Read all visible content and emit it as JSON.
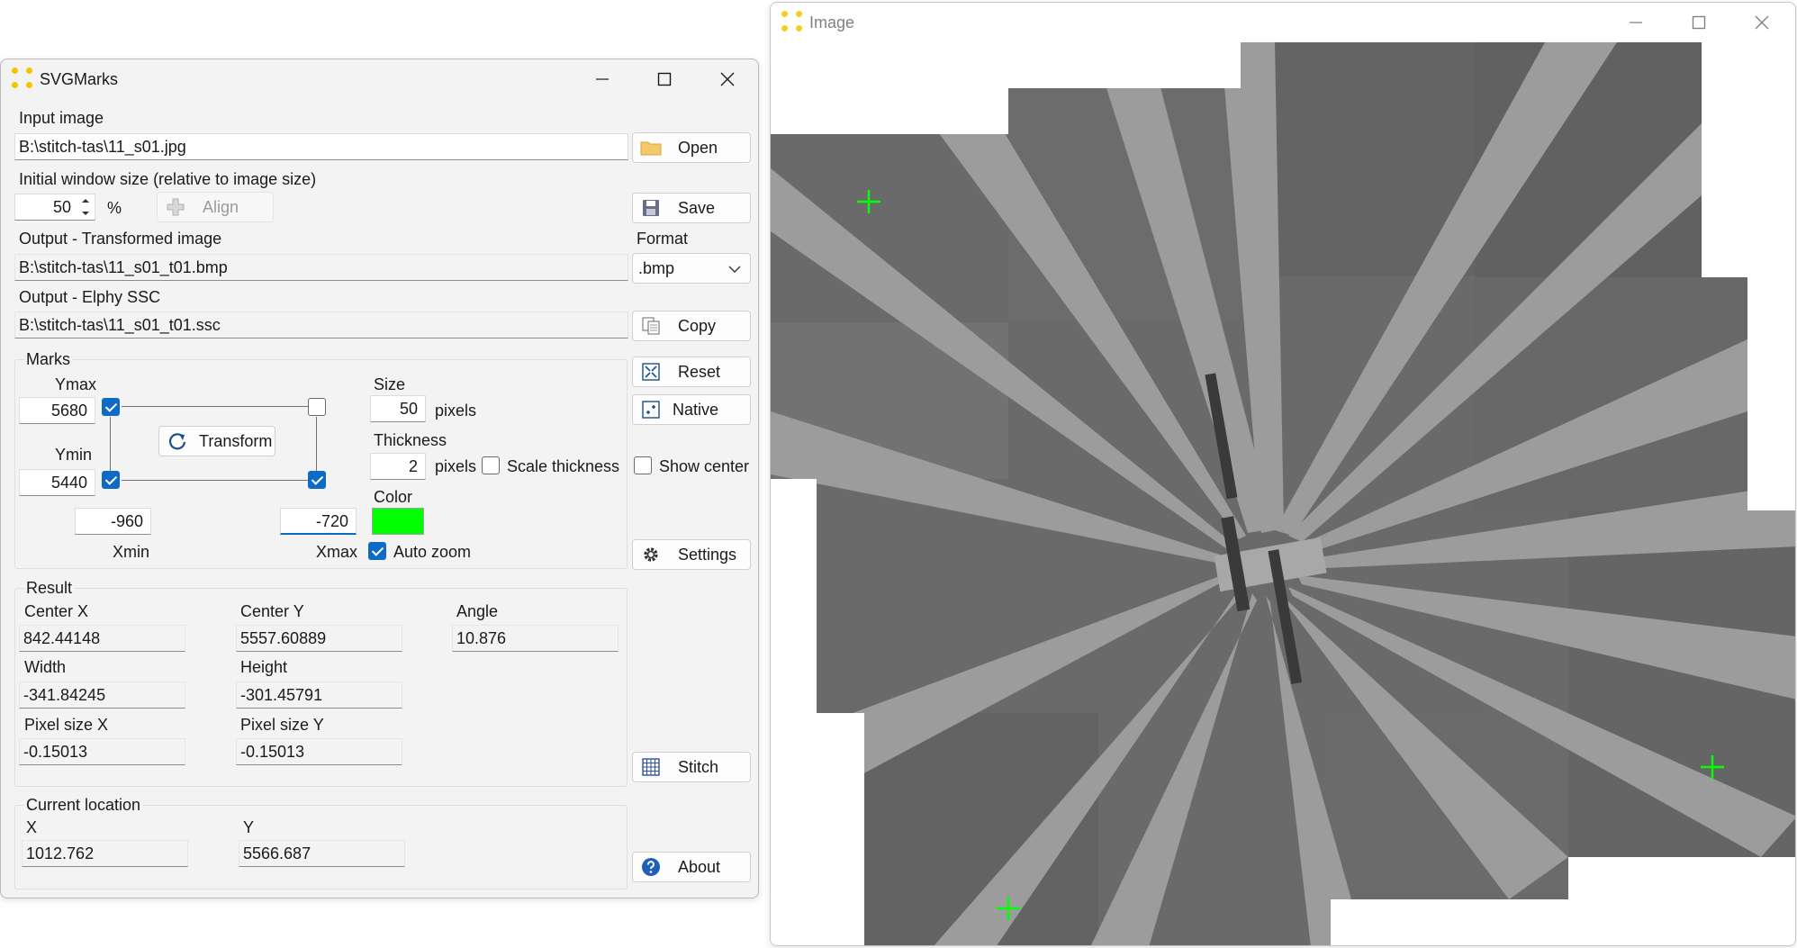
{
  "main_window": {
    "title": "SVGMarks",
    "input_image": {
      "label": "Input image",
      "path": "B:\\stitch-tas\\11_s01.jpg",
      "open_label": "Open"
    },
    "initial_window": {
      "label": "Initial window size (relative to image size)",
      "value": "50",
      "unit": "%",
      "align_label": "Align",
      "save_label": "Save"
    },
    "output_transformed": {
      "label": "Output - Transformed image",
      "path": "B:\\stitch-tas\\11_s01_t01.bmp",
      "format_label": "Format",
      "format_value": ".bmp"
    },
    "output_ssc": {
      "label": "Output - Elphy SSC",
      "path": "B:\\stitch-tas\\11_s01_t01.ssc",
      "copy_label": "Copy"
    },
    "marks": {
      "label": "Marks",
      "ymax_label": "Ymax",
      "ymax": "5680",
      "ymin_label": "Ymin",
      "ymin": "5440",
      "xmin_label": "Xmin",
      "xmin": "-960",
      "xmax_label": "Xmax",
      "xmax": "-720",
      "transform_label": "Transform",
      "size_label": "Size",
      "size": "50",
      "size_unit": "pixels",
      "thickness_label": "Thickness",
      "thickness": "2",
      "thickness_unit": "pixels",
      "scale_thickness_label": "Scale thickness",
      "color_label": "Color",
      "color_value": "#00ff00",
      "auto_zoom_label": "Auto zoom",
      "corner_tl_checked": true,
      "corner_tr_checked": false,
      "corner_bl_checked": true,
      "corner_br_checked": true,
      "scale_thickness_checked": false,
      "auto_zoom_checked": true
    },
    "side_buttons": {
      "reset_label": "Reset",
      "native_label": "Native",
      "show_center_label": "Show center",
      "show_center_checked": false,
      "settings_label": "Settings",
      "stitch_label": "Stitch",
      "about_label": "About"
    },
    "result": {
      "label": "Result",
      "center_x_label": "Center X",
      "center_x": "842.44148",
      "center_y_label": "Center Y",
      "center_y": "5557.60889",
      "angle_label": "Angle",
      "angle": "10.876",
      "width_label": "Width",
      "width": "-341.84245",
      "height_label": "Height",
      "height": "-301.45791",
      "pixel_size_x_label": "Pixel size X",
      "pixel_size_x": "-0.15013",
      "pixel_size_y_label": "Pixel size Y",
      "pixel_size_y": "-0.15013"
    },
    "current_location": {
      "label": "Current location",
      "x_label": "X",
      "x": "1012.762",
      "y_label": "Y",
      "y": "5566.687"
    }
  },
  "image_window": {
    "title": "Image"
  },
  "colors": {
    "accent": "#0e6ac7",
    "mark_color": "#00ff00",
    "window_bg": "#f3f3f3"
  }
}
